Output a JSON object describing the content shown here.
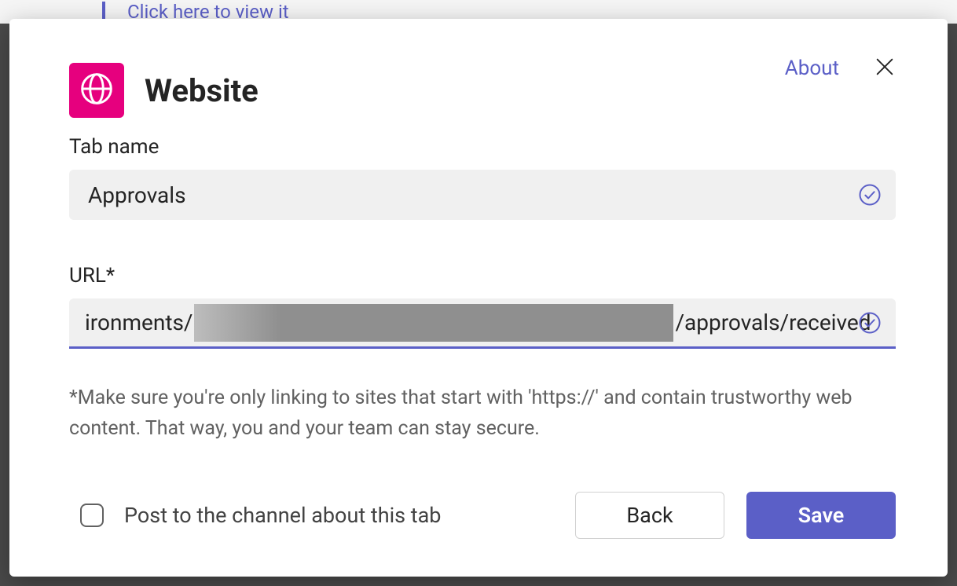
{
  "background": {
    "peek_text": "Click here to view it"
  },
  "dialog": {
    "title": "Website",
    "about_link": "About",
    "tab_name": {
      "label": "Tab name",
      "value": "Approvals"
    },
    "url": {
      "label": "URL*",
      "value_prefix": "ironments/",
      "value_suffix": "/approvals/received"
    },
    "help_text": "*Make sure you're only linking to sites that start with 'https://' and contain trustworthy web content. That way, you and your team can stay secure.",
    "checkbox_label": "Post to the channel about this tab",
    "buttons": {
      "back": "Back",
      "save": "Save"
    }
  }
}
